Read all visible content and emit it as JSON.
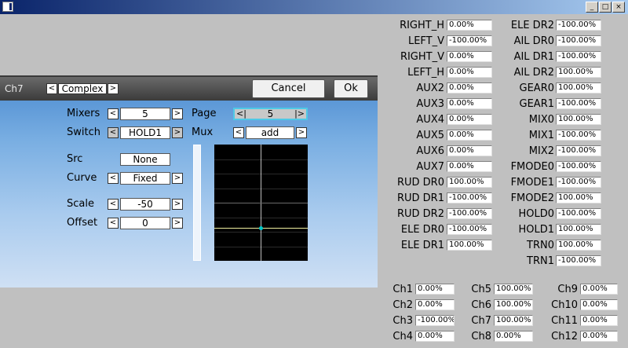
{
  "window": {
    "buttons": {
      "minimize": "_",
      "maximize": "□",
      "close": "×"
    }
  },
  "dialog": {
    "channel": "Ch7",
    "mode": {
      "value": "Complex"
    },
    "cancel_label": "Cancel",
    "ok_label": "Ok",
    "arrow_left": "<",
    "arrow_right": ">",
    "arrow_left_sel": "<|",
    "arrow_right_sel": "|>",
    "fields": {
      "mixers": {
        "label": "Mixers",
        "value": "5"
      },
      "page": {
        "label": "Page",
        "value": "5"
      },
      "switch": {
        "label": "Switch",
        "value": "HOLD1"
      },
      "mux": {
        "label": "Mux",
        "value": "add"
      },
      "src": {
        "label": "Src",
        "value": "None"
      },
      "curve": {
        "label": "Curve",
        "value": "Fixed"
      },
      "scale": {
        "label": "Scale",
        "value": "-50"
      },
      "offset": {
        "label": "Offset",
        "value": "0"
      }
    },
    "curve_colors": {
      "background": "#000000",
      "grid": "#ffffff",
      "curve": "#f0f0a0",
      "point": "#00c8c8"
    }
  },
  "inputs_col1": [
    {
      "label": "RIGHT_H",
      "value": "0.00%"
    },
    {
      "label": "LEFT_V",
      "value": "-100.00%"
    },
    {
      "label": "RIGHT_V",
      "value": "0.00%"
    },
    {
      "label": "LEFT_H",
      "value": "0.00%"
    },
    {
      "label": "AUX2",
      "value": "0.00%"
    },
    {
      "label": "AUX3",
      "value": "0.00%"
    },
    {
      "label": "AUX4",
      "value": "0.00%"
    },
    {
      "label": "AUX5",
      "value": "0.00%"
    },
    {
      "label": "AUX6",
      "value": "0.00%"
    },
    {
      "label": "AUX7",
      "value": "0.00%"
    },
    {
      "label": "RUD DR0",
      "value": "100.00%"
    },
    {
      "label": "RUD DR1",
      "value": "-100.00%"
    },
    {
      "label": "RUD DR2",
      "value": "-100.00%"
    },
    {
      "label": "ELE DR0",
      "value": "-100.00%"
    },
    {
      "label": "ELE DR1",
      "value": "100.00%"
    }
  ],
  "inputs_col2": [
    {
      "label": "ELE DR2",
      "value": "-100.00%"
    },
    {
      "label": "AIL DR0",
      "value": "-100.00%"
    },
    {
      "label": "AIL DR1",
      "value": "-100.00%"
    },
    {
      "label": "AIL DR2",
      "value": "100.00%"
    },
    {
      "label": "GEAR0",
      "value": "100.00%"
    },
    {
      "label": "GEAR1",
      "value": "-100.00%"
    },
    {
      "label": "MIX0",
      "value": "100.00%"
    },
    {
      "label": "MIX1",
      "value": "-100.00%"
    },
    {
      "label": "MIX2",
      "value": "-100.00%"
    },
    {
      "label": "FMODE0",
      "value": "-100.00%"
    },
    {
      "label": "FMODE1",
      "value": "-100.00%"
    },
    {
      "label": "FMODE2",
      "value": "100.00%"
    },
    {
      "label": "HOLD0",
      "value": "-100.00%"
    },
    {
      "label": "HOLD1",
      "value": "100.00%"
    },
    {
      "label": "TRN0",
      "value": "100.00%"
    },
    {
      "label": "TRN1",
      "value": "-100.00%"
    }
  ],
  "channels": [
    {
      "label": "Ch1",
      "value": "0.00%"
    },
    {
      "label": "Ch2",
      "value": "0.00%"
    },
    {
      "label": "Ch3",
      "value": "-100.00%"
    },
    {
      "label": "Ch4",
      "value": "0.00%"
    },
    {
      "label": "Ch5",
      "value": "100.00%"
    },
    {
      "label": "Ch6",
      "value": "100.00%"
    },
    {
      "label": "Ch7",
      "value": "100.00%"
    },
    {
      "label": "Ch8",
      "value": "0.00%"
    },
    {
      "label": "Ch9",
      "value": "0.00%"
    },
    {
      "label": "Ch10",
      "value": "0.00%"
    },
    {
      "label": "Ch11",
      "value": "0.00%"
    },
    {
      "label": "Ch12",
      "value": "0.00%"
    }
  ]
}
